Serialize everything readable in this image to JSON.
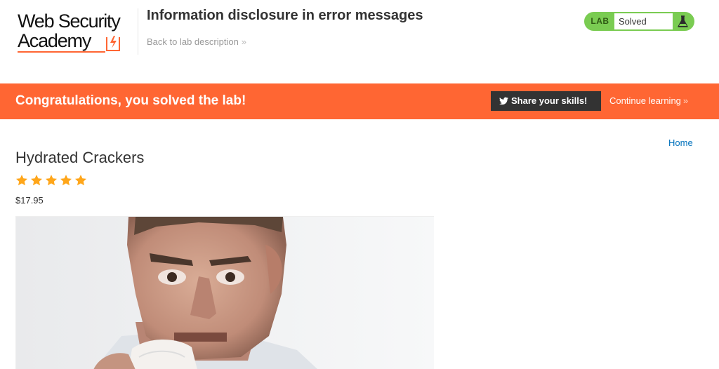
{
  "header": {
    "logo_line1": "Web Security",
    "logo_line2": "Academy",
    "lab_title": "Information disclosure in error messages",
    "back_link": "Back to lab description",
    "status": {
      "tag": "LAB",
      "text": "Solved",
      "color": "#7acc52"
    }
  },
  "banner": {
    "message": "Congratulations, you solved the lab!",
    "share_label": "Share your skills!",
    "continue_label": "Continue learning",
    "color": "#ff6633"
  },
  "nav": {
    "home_label": "Home"
  },
  "product": {
    "name": "Hydrated Crackers",
    "rating": 5,
    "rating_max": 5,
    "price": "$17.95",
    "image_alt": "man-eating-cracker-photo"
  },
  "icons": {
    "logo_mark": "academy-lightning-icon",
    "flask": "flask-icon",
    "twitter": "twitter-bird-icon",
    "chevron": "double-chevron-right-icon",
    "star": "star-icon"
  }
}
